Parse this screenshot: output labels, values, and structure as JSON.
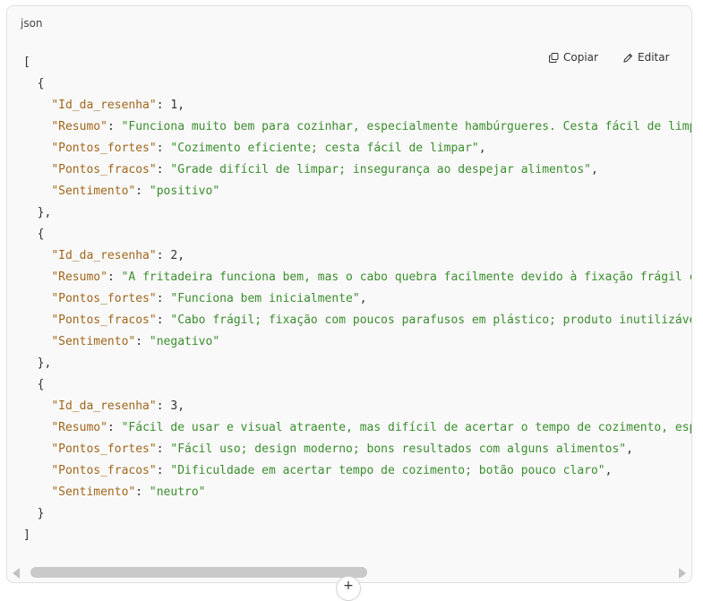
{
  "code_block": {
    "language": "json",
    "copy_label": "Copiar",
    "edit_label": "Editar",
    "lines": [
      "[",
      "  {",
      "    \"Id_da_resenha\": 1,",
      "    \"Resumo\": \"Funciona muito bem para cozinhar, especialmente hambúrgueres. Cesta fácil de limpar",
      "    \"Pontos_fortes\": \"Cozimento eficiente; cesta fácil de limpar\",",
      "    \"Pontos_fracos\": \"Grade difícil de limpar; insegurança ao despejar alimentos\",",
      "    \"Sentimento\": \"positivo\"",
      "  },",
      "  {",
      "    \"Id_da_resenha\": 2,",
      "    \"Resumo\": \"A fritadeira funciona bem, mas o cabo quebra facilmente devido à fixação frágil com",
      "    \"Pontos_fortes\": \"Funciona bem inicialmente\",",
      "    \"Pontos_fracos\": \"Cabo frágil; fixação com poucos parafusos em plástico; produto inutilizável",
      "    \"Sentimento\": \"negativo\"",
      "  },",
      "  {",
      "    \"Id_da_resenha\": 3,",
      "    \"Resumo\": \"Fácil de usar e visual atraente, mas difícil de acertar o tempo de cozimento, espec",
      "    \"Pontos_fortes\": \"Fácil uso; design moderno; bons resultados com alguns alimentos\",",
      "    \"Pontos_fracos\": \"Dificuldade em acertar tempo de cozimento; botão pouco claro\",",
      "    \"Sentimento\": \"neutro\"",
      "  }",
      "]"
    ]
  },
  "colors": {
    "key": "#a0661c",
    "string": "#3b8d2e",
    "number": "#333333",
    "background": "#f9f9f9"
  },
  "icons": {
    "copy": "copy-icon",
    "edit": "pencil-icon",
    "scroll_left": "arrow-left-icon",
    "scroll_right": "arrow-right-icon"
  }
}
